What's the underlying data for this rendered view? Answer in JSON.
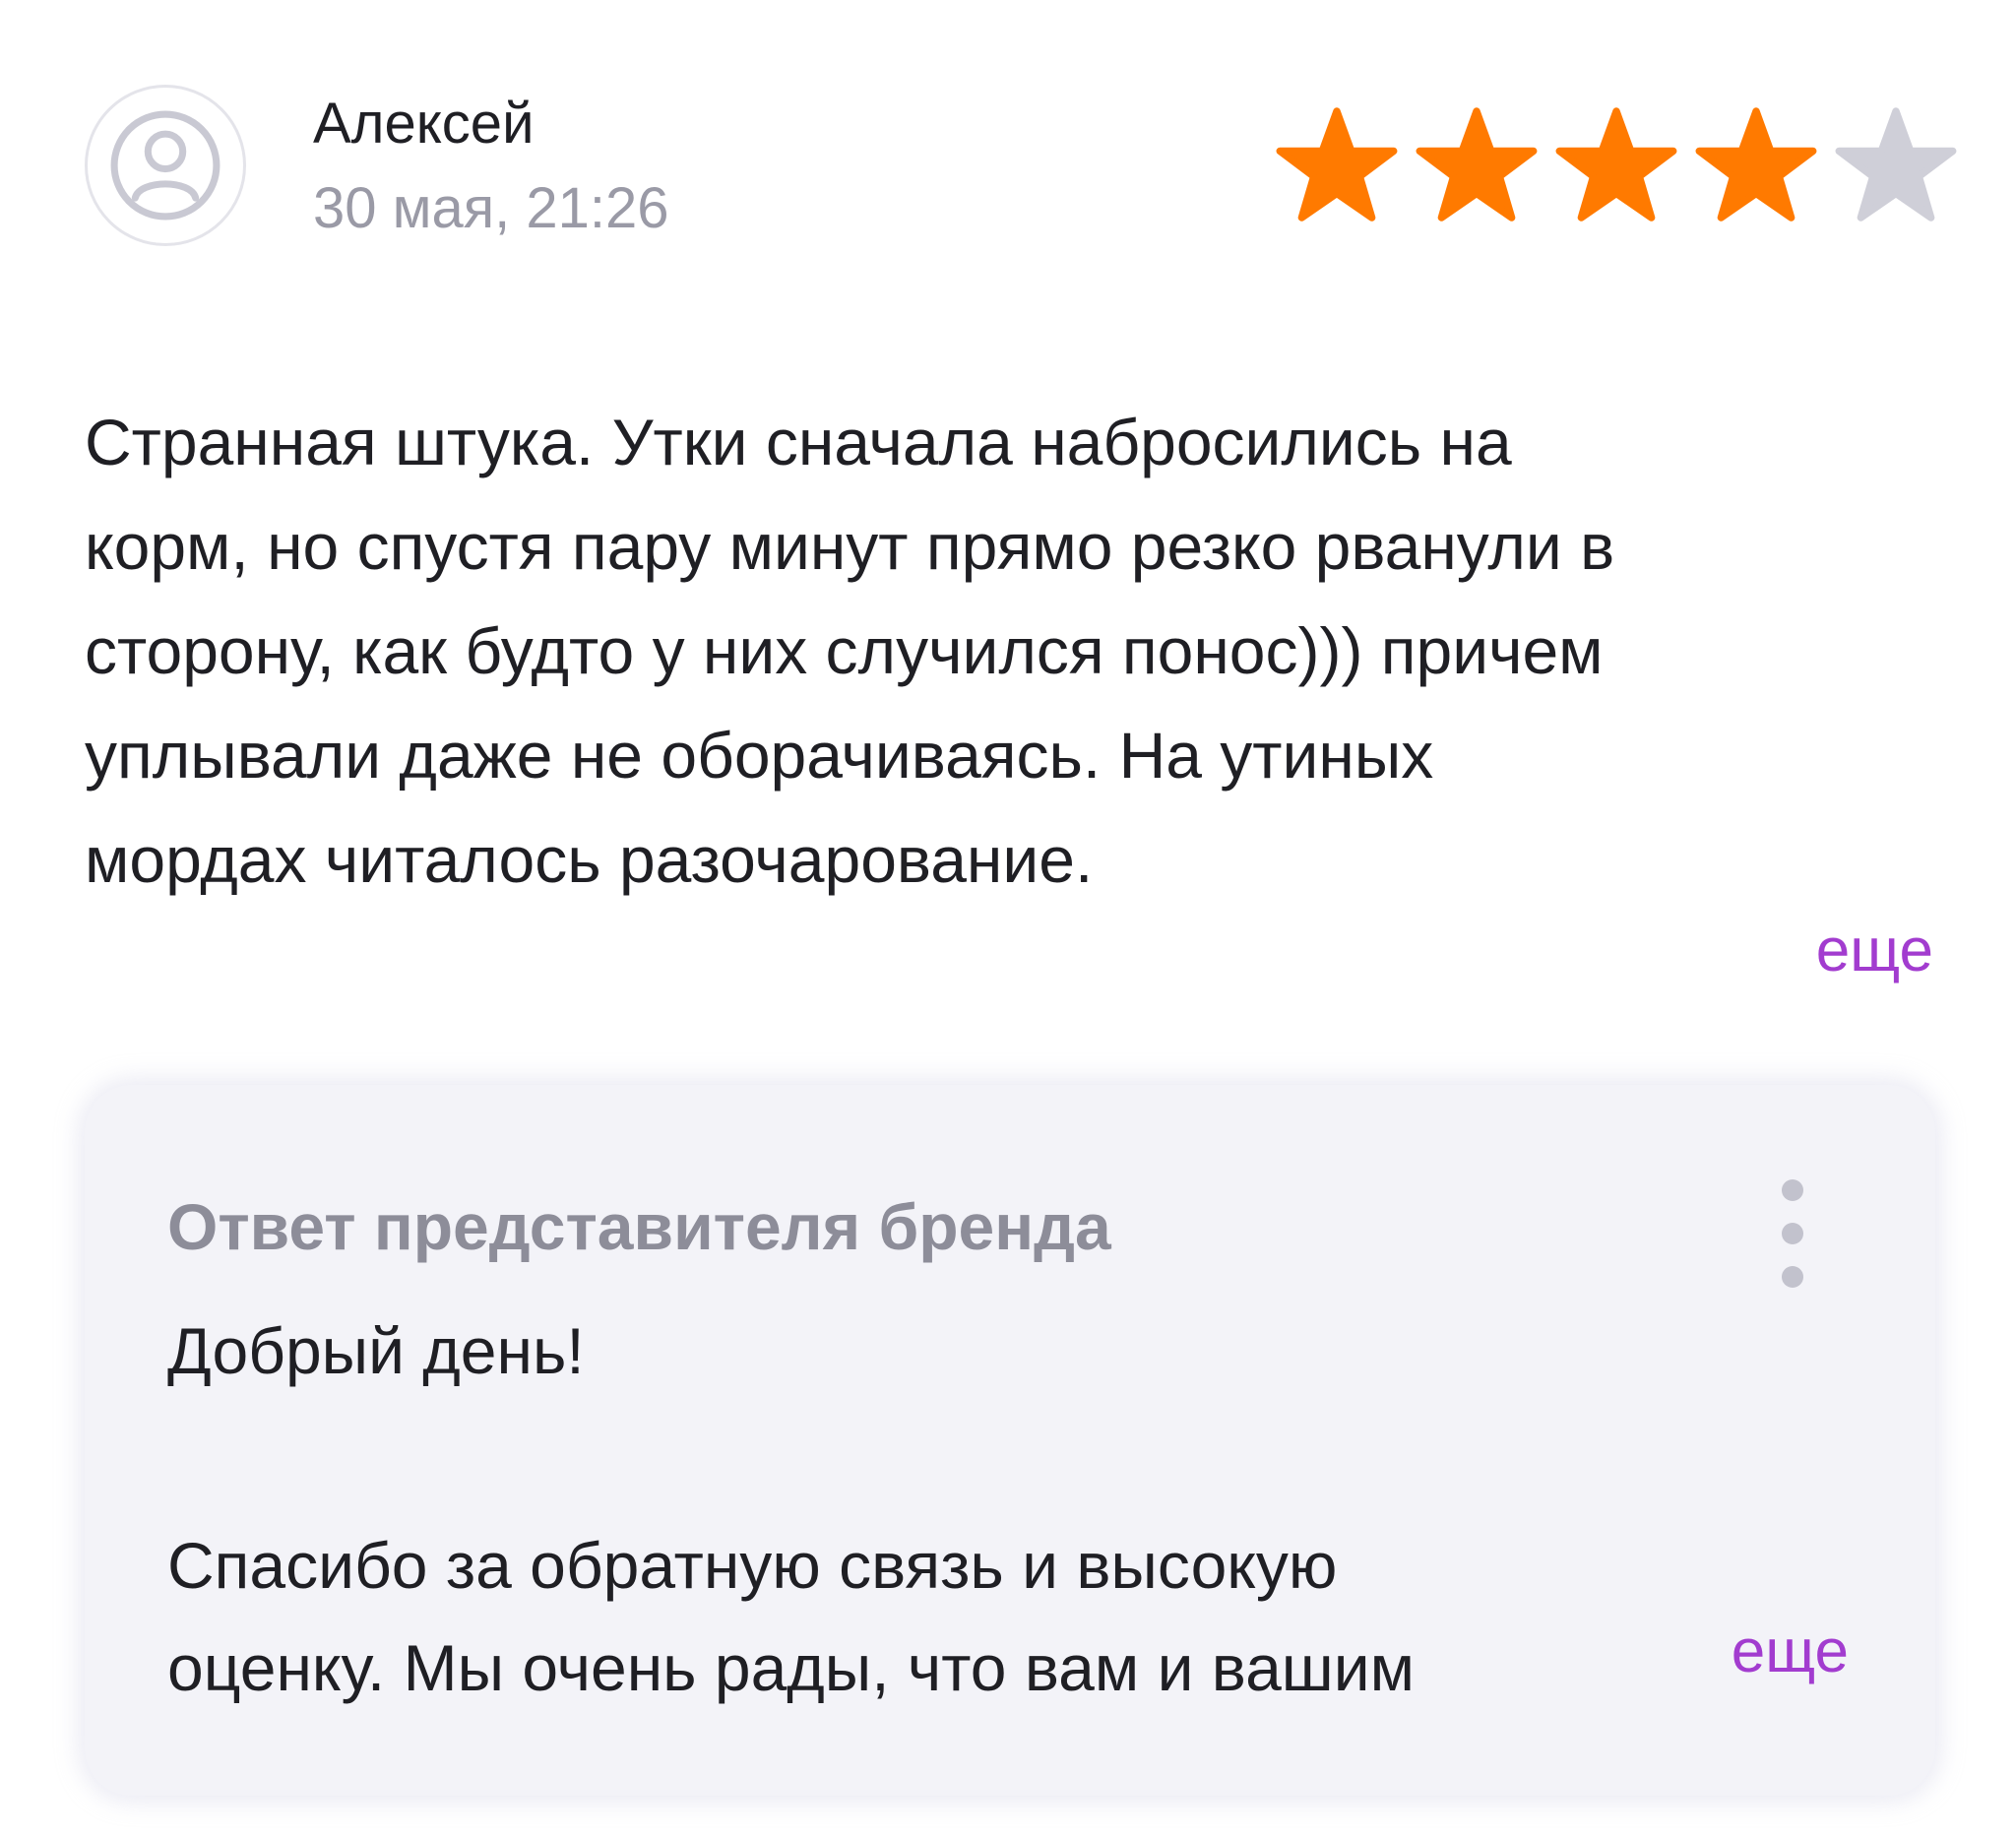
{
  "review": {
    "author": "Алексей",
    "date": "30 мая, 21:26",
    "rating": {
      "value": 4,
      "max": 5
    },
    "text": "Странная штука. Утки сначала набросились на\nкорм, но спустя пару минут прямо резко рванули в\nсторону, как будто у них случился понос))) причем\nуплывали даже не оборачиваясь. На утиных\nмордах читалось разочарование.",
    "more_label": "еще"
  },
  "brand_reply": {
    "title": "Ответ представителя бренда",
    "greeting": "Добрый день!",
    "text": "Спасибо за обратную связь и высокую\nоценку. Мы очень рады, что вам и вашим",
    "more_label": "еще"
  },
  "colors": {
    "star_filled": "#ff7a00",
    "star_empty": "#cfcfd8",
    "link": "#a23ccf",
    "muted_text": "#9a9aa6",
    "reply_bg": "#f3f3f8"
  },
  "icons": {
    "avatar": "user-avatar-icon",
    "star": "star-icon",
    "menu": "kebab-menu-icon"
  }
}
